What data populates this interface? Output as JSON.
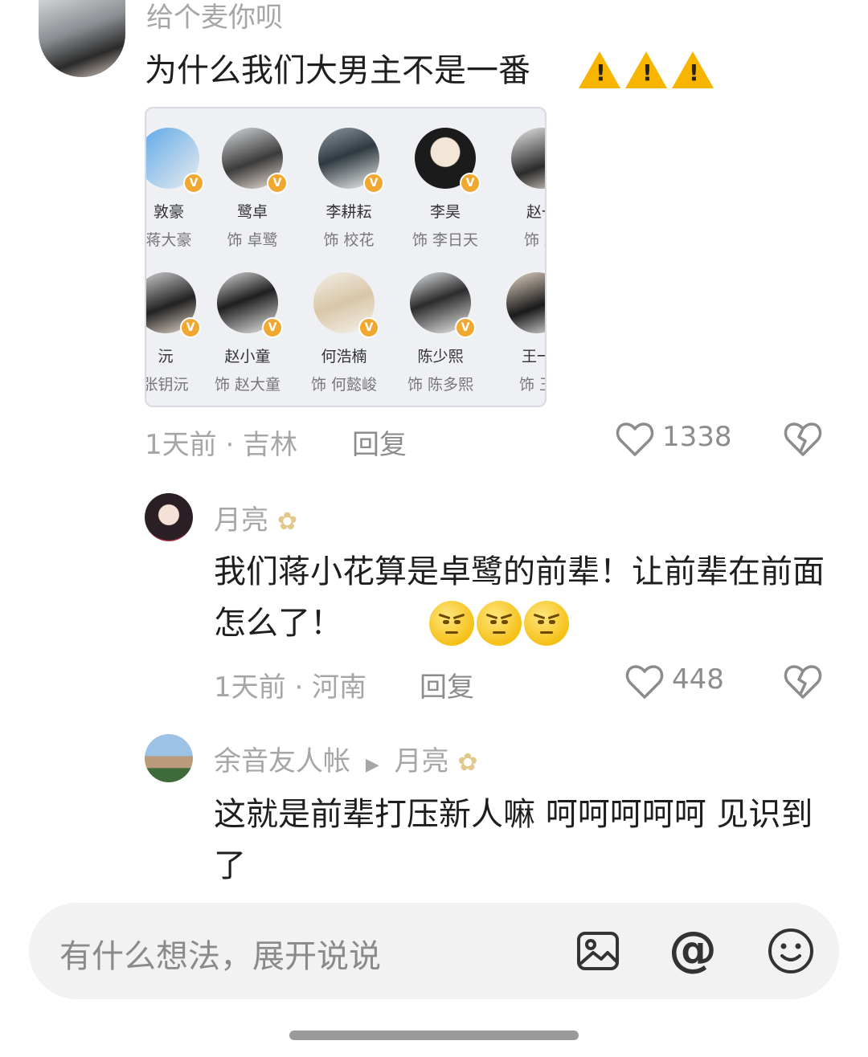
{
  "comment1": {
    "username": "给个麦你呗",
    "text": "为什么我们大男主不是一番",
    "time_location": "1天前 · 吉林",
    "reply_label": "回复",
    "likes": "1338",
    "image_cast": [
      {
        "actor": "敦豪",
        "role": "蒋大豪"
      },
      {
        "actor": "鹭卓",
        "role": "饰 卓鹭"
      },
      {
        "actor": "李耕耘",
        "role": "饰 校花"
      },
      {
        "actor": "李昊",
        "role": "饰 李日天"
      },
      {
        "actor": "赵一",
        "role": "饰 赵"
      },
      {
        "actor": "沅",
        "role": "张钥沅"
      },
      {
        "actor": "赵小童",
        "role": "饰 赵大童"
      },
      {
        "actor": "何浩楠",
        "role": "饰 何懿峻"
      },
      {
        "actor": "陈少熙",
        "role": "饰 陈多熙"
      },
      {
        "actor": "王一",
        "role": "饰 王"
      }
    ]
  },
  "comment2": {
    "username": "月亮",
    "text": "我们蒋小花算是卓鹭的前辈！让前辈在前面怎么了！",
    "time_location": "1天前 · 河南",
    "reply_label": "回复",
    "likes": "448"
  },
  "comment3": {
    "username": "余音友人帐",
    "reply_to": "月亮",
    "text": "这就是前辈打压新人嘛 呵呵呵呵呵 见识到了"
  },
  "input": {
    "placeholder": "有什么想法，展开说说"
  },
  "colors": {
    "muted_text": "#a6a6a6",
    "badge": "#f0a830",
    "warning": "#f7b500"
  }
}
